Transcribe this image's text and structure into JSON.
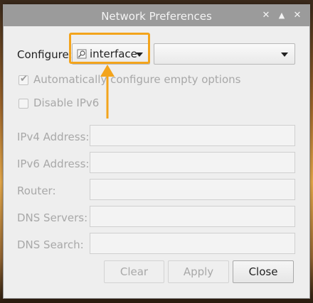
{
  "window": {
    "title": "Network Preferences"
  },
  "configure": {
    "label": "Configure:",
    "type_select": "interface",
    "type_icon": "network-interface-icon",
    "item_select": ""
  },
  "options": {
    "auto_configure_label": "Automatically configure empty options",
    "auto_configure_checked": true,
    "disable_ipv6_label": "Disable IPv6",
    "disable_ipv6_checked": false
  },
  "fields": [
    {
      "label": "IPv4 Address:",
      "value": ""
    },
    {
      "label": "IPv6 Address:",
      "value": ""
    },
    {
      "label": "Router:",
      "value": ""
    },
    {
      "label": "DNS Servers:",
      "value": ""
    },
    {
      "label": "DNS Search:",
      "value": ""
    }
  ],
  "buttons": {
    "clear": "Clear",
    "apply": "Apply",
    "close": "Close"
  },
  "colors": {
    "highlight": "#f3a41c",
    "disabled_text": "#a8a8a8"
  }
}
